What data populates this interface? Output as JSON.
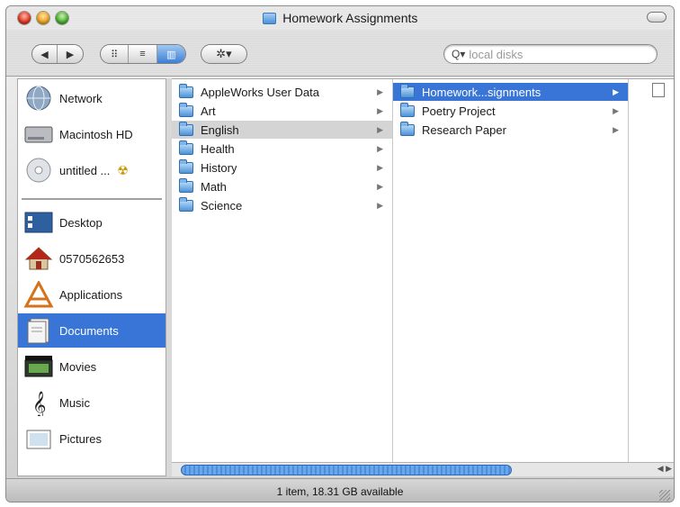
{
  "window": {
    "title": "Homework Assignments"
  },
  "toolbar": {
    "back_label": "◀",
    "forward_label": "▶",
    "icon_view_label": "⠿",
    "list_view_label": "≡",
    "column_view_label": "▥",
    "action_label": "✲▾",
    "search_placeholder": "local disks",
    "search_icon_glyph": "Q▾"
  },
  "sidebar": {
    "devices": [
      {
        "label": "Network",
        "icon": "network-globe-icon"
      },
      {
        "label": "Macintosh HD",
        "icon": "hard-drive-icon"
      },
      {
        "label": "untitled ...",
        "icon": "cd-disc-icon",
        "eject": "☢"
      }
    ],
    "places": [
      {
        "label": "Desktop",
        "icon": "desktop-icon"
      },
      {
        "label": "0570562653",
        "icon": "home-icon"
      },
      {
        "label": "Applications",
        "icon": "applications-icon"
      },
      {
        "label": "Documents",
        "icon": "documents-icon",
        "selected": true
      },
      {
        "label": "Movies",
        "icon": "movies-icon"
      },
      {
        "label": "Music",
        "icon": "music-icon"
      },
      {
        "label": "Pictures",
        "icon": "pictures-icon"
      }
    ]
  },
  "columns": {
    "col1": [
      {
        "name": "AppleWorks User Data",
        "arrow": "▶"
      },
      {
        "name": "Art",
        "arrow": "▶"
      },
      {
        "name": "English",
        "arrow": "▶",
        "selected": "gray"
      },
      {
        "name": "Health",
        "arrow": "▶"
      },
      {
        "name": "History",
        "arrow": "▶"
      },
      {
        "name": "Math",
        "arrow": "▶"
      },
      {
        "name": "Science",
        "arrow": "▶"
      }
    ],
    "col2": [
      {
        "name": "Homework...signments",
        "arrow": "▶",
        "selected": "blue"
      },
      {
        "name": "Poetry Project",
        "arrow": "▶"
      },
      {
        "name": "Research Paper",
        "arrow": "▶"
      }
    ]
  },
  "scrollbar": {
    "arrows": "◀ ▶"
  },
  "status": {
    "text": "1 item, 18.31 GB available"
  },
  "colors": {
    "selection_blue": "#3875d7",
    "selection_gray": "#d4d4d4"
  }
}
